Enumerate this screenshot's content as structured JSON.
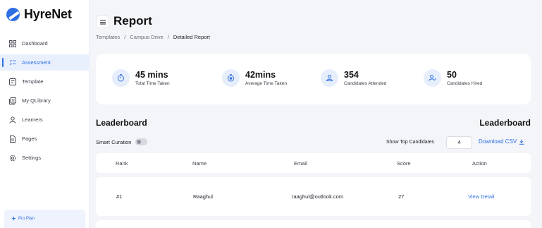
{
  "app": {
    "brand": "HyreNet"
  },
  "sidebar": {
    "items": [
      {
        "label": "Dashboard",
        "icon": "dashboard-icon",
        "active": false
      },
      {
        "label": "Assessment",
        "icon": "assessment-icon",
        "active": true
      },
      {
        "label": "Template",
        "icon": "template-icon",
        "active": false
      },
      {
        "label": "My QLibrary",
        "icon": "library-icon",
        "active": false
      },
      {
        "label": "Learners",
        "icon": "learners-icon",
        "active": false
      },
      {
        "label": "Pages",
        "icon": "pages-icon",
        "active": false
      },
      {
        "label": "Settings",
        "icon": "settings-icon",
        "active": false
      }
    ],
    "plan": "Pro Plan"
  },
  "header": {
    "title": "Report",
    "breadcrumb": [
      "Templates",
      "Campus Drive",
      "Detailed Report"
    ]
  },
  "stats": [
    {
      "value": "45 mins",
      "label": "Total Time Taken",
      "icon": "timer-icon"
    },
    {
      "value": "42mins",
      "label": "Average Time Taken",
      "icon": "average-timer-icon"
    },
    {
      "value": "354",
      "label": "Candidates Attended",
      "icon": "candidates-icon"
    },
    {
      "value": "50",
      "label": "Candidates Hired",
      "icon": "hired-icon"
    }
  ],
  "leaderboard": {
    "title": "Leaderboard",
    "title_right": "Leaderboard",
    "smart_curation": "Smart Curation",
    "smart_curation_on": false,
    "show_top_label": "Show Top Candidates",
    "show_top_value": "4",
    "download_label": "Download CSV",
    "columns": [
      "Rank",
      "Name",
      "Email",
      "Score",
      "Action"
    ],
    "rows": [
      {
        "rank": "#1",
        "name": "Raaghul",
        "email": "raaghul@outlook.com",
        "score": "27",
        "action": "View Detail"
      }
    ]
  },
  "colors": {
    "accent": "#2f6fe4",
    "background": "#f4f5f9",
    "active_bg": "#e9f0fd"
  }
}
